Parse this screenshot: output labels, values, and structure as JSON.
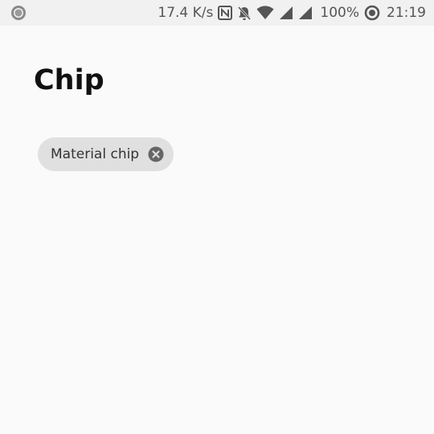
{
  "status_bar": {
    "network_speed": "17.4 K/s",
    "battery_percent": "100%",
    "time": "21:19",
    "icons": [
      "record-icon",
      "nfc-icon",
      "notifications-off-icon",
      "wifi-icon",
      "signal-icon",
      "signal-icon",
      "battery-saver-icon"
    ],
    "color": "#555555",
    "background": "#f1f1f1"
  },
  "page": {
    "title": "Chip",
    "background": "#fafafa"
  },
  "chip": {
    "label": "Material chip",
    "background": "#e0e0e0",
    "close_icon_color": "#666666",
    "close_icon": "close-circle-icon"
  }
}
